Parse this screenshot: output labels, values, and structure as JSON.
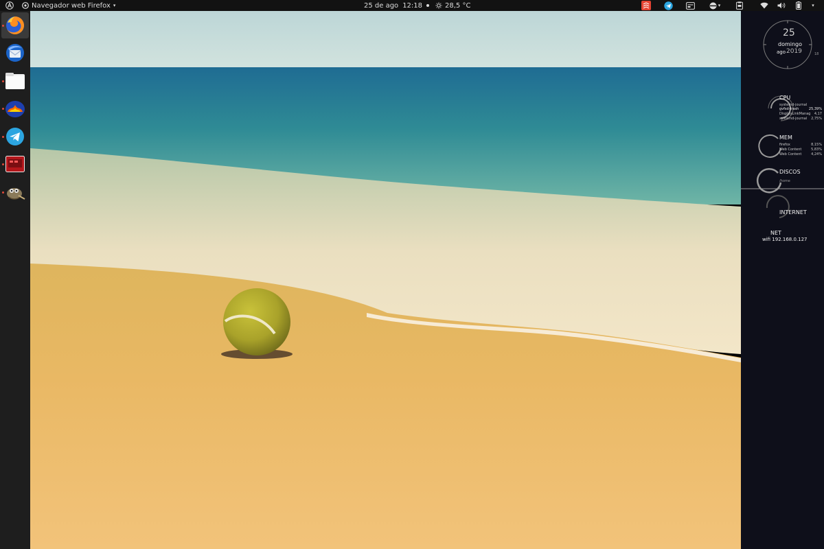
{
  "topbar": {
    "app_title": "Navegador web Firefox",
    "date": "25 de ago",
    "time": "12:18",
    "temperature": "28,5 °C"
  },
  "dock": {
    "items": [
      {
        "name": "firefox",
        "active": true
      },
      {
        "name": "thunderbird"
      },
      {
        "name": "files"
      },
      {
        "name": "app-4"
      },
      {
        "name": "telegram"
      },
      {
        "name": "app-6"
      },
      {
        "name": "gimp"
      }
    ]
  },
  "conky": {
    "clock": {
      "day": "25",
      "weekday": "domingo",
      "month": "ago",
      "year": "2019",
      "hour_mark": "18"
    },
    "cpu": {
      "label": "CPU",
      "processes": [
        {
          "name": "systemd-journal",
          "value": ""
        },
        {
          "name": "gvfsd-trash",
          "value": "25,39%"
        },
        {
          "name": "DisplayLinkManag",
          "value": "4,17"
        },
        {
          "name": "systemd-journal",
          "value": "2,75%"
        }
      ]
    },
    "mem": {
      "label": "MEM",
      "processes": [
        {
          "name": "firefox",
          "value": "8,15%"
        },
        {
          "name": "Web Content",
          "value": "5,83%"
        },
        {
          "name": "Web Content",
          "value": "4,24%"
        }
      ]
    },
    "disks": {
      "label": "DISCOS",
      "mount": "/home"
    },
    "internet": {
      "label": "INTERNET"
    },
    "net": {
      "label": "NET",
      "info": "wifi 192.168.0.127"
    }
  }
}
